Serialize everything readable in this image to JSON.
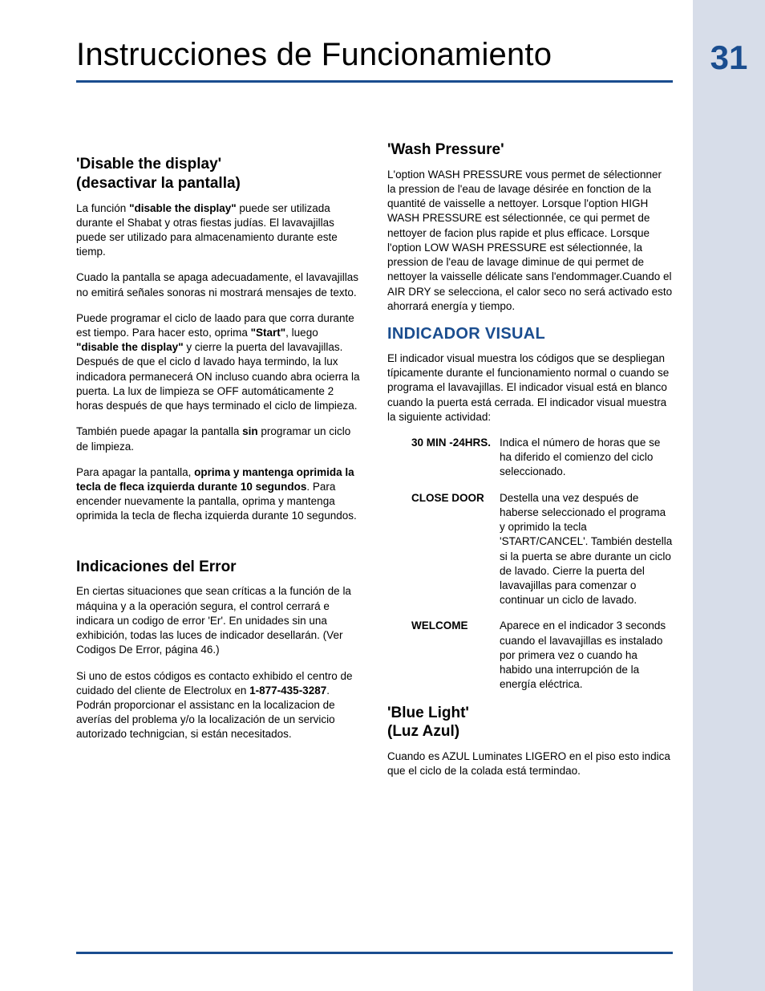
{
  "page_number": "31",
  "page_title": "Instrucciones de Funcionamiento",
  "left": {
    "s1": {
      "heading_l1": "'Disable the display'",
      "heading_l2": "(desactivar la pantalla)",
      "p1a": "La función ",
      "p1b": "\"disable the display\"",
      "p1c": " puede ser utilizada durante el Shabat y otras fiestas judías.  El lavavajillas puede ser utilizado para almacenamiento durante este tiemp.",
      "p2": "Cuado la pantalla se apaga adecuadamente, el lavavajillas no emitirá señales sonoras ni mostrará mensajes de texto.",
      "p3a": "Puede programar el ciclo de laado para que corra durante est tiempo.  Para hacer esto, oprima ",
      "p3b": "\"Start\"",
      "p3c": ", luego ",
      "p3d": "\"disable the display\"",
      "p3e": " y cierre la puerta del lavavajillas.  Después de que el ciclo d lavado haya termindo, la lux indicadora permanecerá ON incluso cuando abra ocierra la puerta.  La lux de limpieza se OFF automáticamente 2 horas después de que hays terminado el ciclo de limpieza.",
      "p4a": "También puede apagar la pantalla ",
      "p4b": "sin",
      "p4c": " programar un ciclo de limpieza.",
      "p5a": "Para apagar la pantalla, ",
      "p5b": "oprima y mantenga oprimida la tecla de fleca izquierda durante 10 segundos",
      "p5c": ".  Para encender nuevamente la pantalla, oprima y mantenga oprimida la tecla de flecha izquierda durante 10 segundos."
    },
    "s2": {
      "heading": "Indicaciones del Error",
      "p1": "En ciertas situaciones que sean críticas a la función de la máquina y a la operación segura, el control cerrará e indicara un codigo de error 'Er'.  En unidades sin una exhibición, todas las luces de indicador desellarán. (Ver Codigos De Error, página 46.)",
      "p2a": "Si uno de estos códigos es contacto exhibido el centro de cuidado del cliente de Electrolux en ",
      "p2b": "1-877-435-3287",
      "p2c": ".  Podrán proporcionar el assistanc en la localizacion de averías del problema y/o la localización de un servicio autorizado technigcian, si están necesitados."
    }
  },
  "right": {
    "s1": {
      "heading": "'Wash Pressure'",
      "p1": "L'option WASH PRESSURE vous permet de sélectionner la pression de l'eau de lavage désirée en fonction de la quantité de vaisselle a nettoyer.  Lorsque l'option HIGH WASH PRESSURE est sélectionnée, ce qui permet de nettoyer de facion plus rapide et plus efficace.  Lorsque l'option LOW WASH PRESSURE est sélectionnée, la pression de l'eau de lavage diminue de qui permet de nettoyer la vaisselle délicate sans l'endommager.Cuando el AIR DRY se selecciona, el calor seco no será activado esto ahorrará energía y tiempo."
    },
    "s2": {
      "heading": "INDICADOR VISUAL",
      "p1": "El indicador visual muestra los códigos que se despliegan típicamente durante el funcionamiento normal o cuando se programa el lavavajillas.  El indicador visual está en blanco cuando la puerta está cerrada.  El indicador visual muestra la siguiente actividad:",
      "rows": [
        {
          "label": "30 MIN -24HRS.",
          "desc": "Indica el número de horas que se ha diferido el comienzo del ciclo seleccionado."
        },
        {
          "label": "CLOSE DOOR",
          "desc": "Destella una vez después de haberse seleccionado el programa y oprimido la tecla 'START/CANCEL'.  También destella si la puerta se abre durante un ciclo de lavado.  Cierre la puerta del lavavajillas para comenzar o continuar un ciclo de lavado."
        },
        {
          "label": "WELCOME",
          "desc": "Aparece en el indicador 3 seconds cuando el lavavajillas es instalado por primera vez o cuando ha habido una interrupción de la energía eléctrica."
        }
      ]
    },
    "s3": {
      "heading_l1": "'Blue Light'",
      "heading_l2": "(Luz Azul)",
      "p1": "Cuando es AZUL Luminates LIGERO en el piso esto indica que el ciclo de la colada está termindao."
    }
  }
}
